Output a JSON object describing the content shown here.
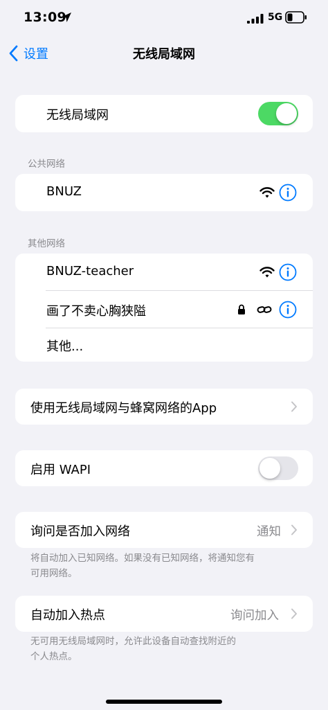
{
  "status_bar": {
    "time": "13:09",
    "network": "5G"
  },
  "nav": {
    "back_label": "设置",
    "title": "无线局域网"
  },
  "wifi_toggle": {
    "label": "无线局域网",
    "on": true
  },
  "public_networks": {
    "header": "公共网络",
    "items": [
      {
        "name": "BNUZ"
      }
    ]
  },
  "other_networks": {
    "header": "其他网络",
    "items": [
      {
        "name": "BNUZ-teacher"
      },
      {
        "name": "画了不卖心胸狭隘"
      },
      {
        "name": "其他..."
      }
    ]
  },
  "apps_row": {
    "label": "使用无线局域网与蜂窝网络的App"
  },
  "wapi": {
    "label": "启用 WAPI",
    "on": false
  },
  "ask_join": {
    "label": "询问是否加入网络",
    "value": "通知",
    "footnote_line1": "将自动加入已知网络。如果没有已知网络，将通知您有",
    "footnote_line2": "可用网络。"
  },
  "hotspot": {
    "label": "自动加入热点",
    "value": "询问加入",
    "footnote_line1": "无可用无线局域网时，允许此设备自动查找附近的",
    "footnote_line2": "个人热点。"
  },
  "colors": {
    "accent": "#007aff",
    "toggle_on": "#4cd964",
    "background": "#f2f2f7"
  }
}
